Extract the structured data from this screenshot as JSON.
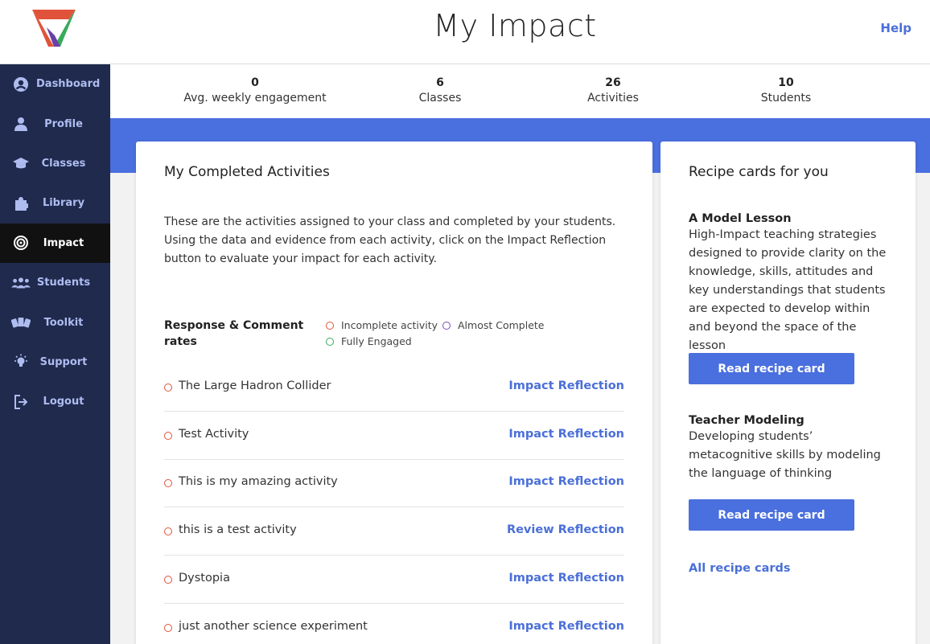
{
  "header": {
    "title": "My Impact",
    "help_label": "Help"
  },
  "sidebar": {
    "items": [
      {
        "label": "Dashboard",
        "icon": "user-circle-icon",
        "active": false
      },
      {
        "label": "Profile",
        "icon": "person-icon",
        "active": false
      },
      {
        "label": "Classes",
        "icon": "graduation-cap-icon",
        "active": false
      },
      {
        "label": "Library",
        "icon": "puzzle-icon",
        "active": false
      },
      {
        "label": "Impact",
        "icon": "target-icon",
        "active": true
      },
      {
        "label": "Students",
        "icon": "group-icon",
        "active": false
      },
      {
        "label": "Toolkit",
        "icon": "cards-icon",
        "active": false
      },
      {
        "label": "Support",
        "icon": "lightbulb-icon",
        "active": false
      },
      {
        "label": "Logout",
        "icon": "logout-icon",
        "active": false
      }
    ]
  },
  "stats": [
    {
      "value": "0",
      "label": "Avg. weekly engagement"
    },
    {
      "value": "6",
      "label": "Classes"
    },
    {
      "value": "26",
      "label": "Activities"
    },
    {
      "value": "10",
      "label": "Students"
    }
  ],
  "activities_card": {
    "title": "My Completed Activities",
    "intro": "These are the activities assigned to your class and completed by your students. Using the data and evidence from each activity, click on the Impact Reflection button to evaluate your impact for each activity.",
    "legend_title": "Response & Comment rates",
    "legend": {
      "incomplete": "Incomplete activity",
      "almost": "Almost Complete",
      "engaged": "Fully Engaged"
    },
    "rows": [
      {
        "name": "The Large Hadron Collider",
        "action": "Impact Reflection",
        "status": "incomplete"
      },
      {
        "name": "Test Activity",
        "action": "Impact Reflection",
        "status": "incomplete"
      },
      {
        "name": "This is my amazing activity",
        "action": "Impact Reflection",
        "status": "incomplete"
      },
      {
        "name": "this is a test activity",
        "action": "Review Reflection",
        "status": "incomplete"
      },
      {
        "name": "Dystopia",
        "action": "Impact Reflection",
        "status": "incomplete"
      },
      {
        "name": "just another science experiment",
        "action": "Impact Reflection",
        "status": "incomplete"
      }
    ]
  },
  "recipes_card": {
    "title": "Recipe cards for you",
    "recipes": [
      {
        "title": "A Model Lesson",
        "description": "High-Impact teaching strategies designed to provide clarity on the knowledge, skills, attitudes and key understandings that students are expected to develop within and beyond the space of the lesson",
        "button": "Read recipe card"
      },
      {
        "title": "Teacher Modeling",
        "description": "Developing students’ metacognitive skills by modeling the language of thinking",
        "button": "Read recipe card"
      }
    ],
    "all_link": "All recipe cards"
  },
  "colors": {
    "accent": "#4a6fde",
    "sidebar": "#1f2a4d",
    "incomplete": "#e0533a",
    "almost": "#7b4bb3",
    "engaged": "#3aaa5c"
  }
}
